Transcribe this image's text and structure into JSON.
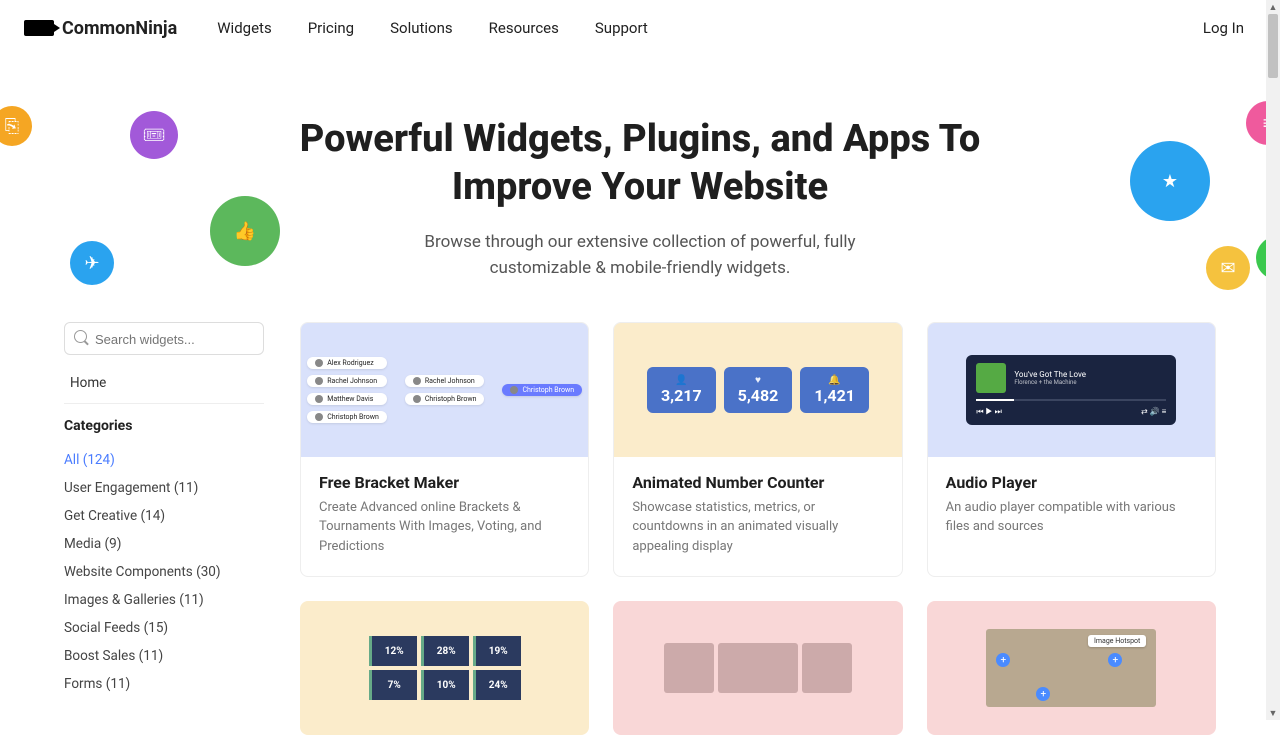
{
  "brand": "CommonNinja",
  "nav": [
    "Widgets",
    "Pricing",
    "Solutions",
    "Resources",
    "Support"
  ],
  "login": "Log In",
  "hero": {
    "title": "Powerful Widgets, Plugins, and Apps To Improve Your Website",
    "subtitle": "Browse through our extensive collection of powerful, fully customizable & mobile-friendly widgets."
  },
  "search_placeholder": "Search widgets...",
  "sidebar_home": "Home",
  "categories_title": "Categories",
  "categories": [
    {
      "label": "All (124)",
      "active": true
    },
    {
      "label": "User Engagement (11)"
    },
    {
      "label": "Get Creative (14)"
    },
    {
      "label": "Media (9)"
    },
    {
      "label": "Website Components (30)"
    },
    {
      "label": "Images & Galleries (11)"
    },
    {
      "label": "Social Feeds (15)"
    },
    {
      "label": "Boost Sales (11)"
    },
    {
      "label": "Forms (11)"
    }
  ],
  "cards": [
    {
      "title": "Free Bracket Maker",
      "desc": "Create Advanced online Brackets & Tournaments With Images, Voting, and Predictions",
      "names": [
        "Alex Rodriguez",
        "Rachel Johnson",
        "Matthew Davis",
        "Christoph Brown",
        "Rachel Johnson",
        "Christoph Brown",
        "Christoph Brown"
      ]
    },
    {
      "title": "Animated Number Counter",
      "desc": "Showcase statistics, metrics, or countdowns in an animated visually appealing display",
      "counters": [
        "3,217",
        "5,482",
        "1,421"
      ]
    },
    {
      "title": "Audio Player",
      "desc": "An audio player compatible with various files and sources",
      "track": {
        "t": "You've Got The Love",
        "s": "Florence + the Machine"
      }
    }
  ],
  "row2_bars": [
    "12%",
    "28%",
    "19%",
    "7%",
    "10%",
    "24%"
  ],
  "hotspot_label": "Image Hotspot"
}
